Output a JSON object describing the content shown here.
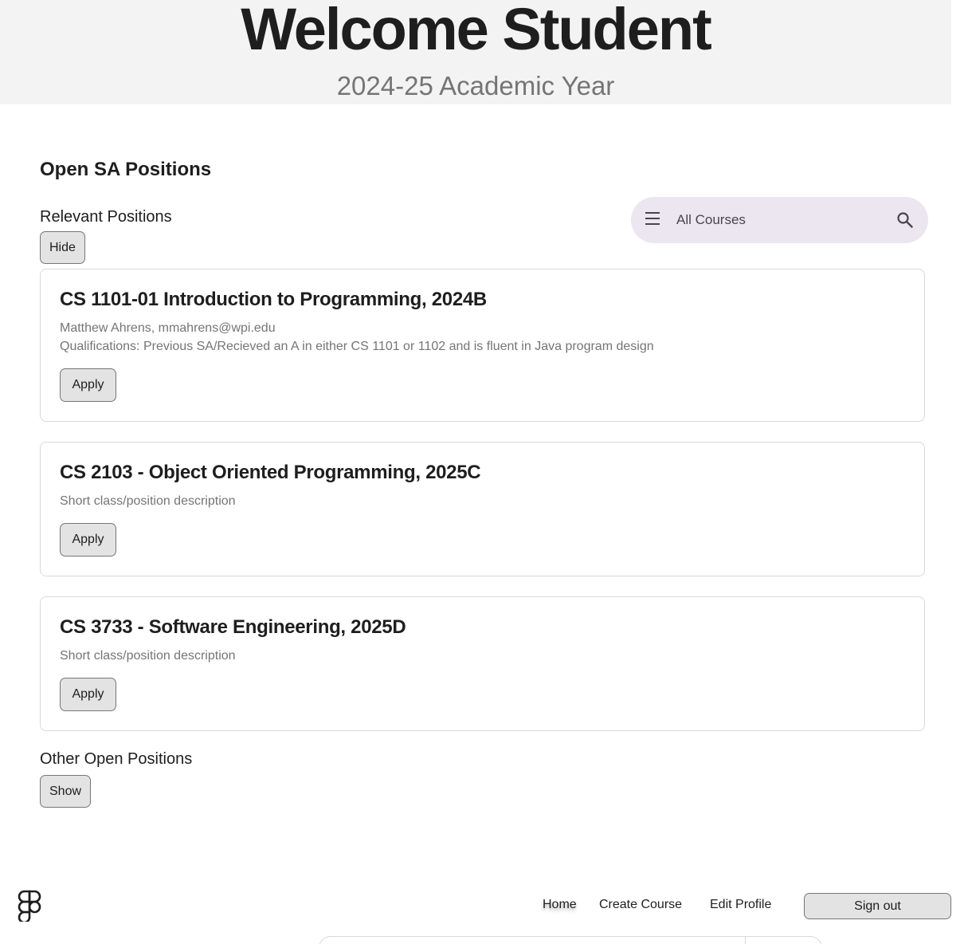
{
  "hero": {
    "title": "Welcome Student",
    "subtitle": "2024-25 Academic Year"
  },
  "main": {
    "section_title": "Open SA Positions",
    "relevant": {
      "label": "Relevant Positions",
      "toggle_label": "Hide"
    },
    "search": {
      "placeholder": "All Courses",
      "menu_icon": "menu-icon",
      "search_icon": "search-icon"
    },
    "positions": [
      {
        "title": "CS 1101-01 Introduction to Programming, 2024B",
        "line1": "Matthew Ahrens, mmahrens@wpi.edu",
        "line2": "Qualifications: Previous SA/Recieved an A in either CS 1101 or 1102 and is fluent in Java program design",
        "apply_label": "Apply"
      },
      {
        "title": "CS 2103 - Object Oriented Programming, 2025C",
        "line1": "Short class/position description",
        "apply_label": "Apply"
      },
      {
        "title": "CS 3733 - Software Engineering, 2025D",
        "line1": "Short class/position description",
        "apply_label": "Apply"
      }
    ],
    "other": {
      "label": "Other Open Positions",
      "toggle_label": "Show"
    }
  },
  "footer": {
    "logo_icon": "figma-logo-icon",
    "nav": [
      "Home",
      "Create Course",
      "Edit Profile"
    ],
    "signout_label": "Sign out"
  },
  "colors": {
    "hero_bg": "#f3f3f3",
    "search_bg": "#ece6f0",
    "button_bg": "#e3e3e3",
    "text": "#1e1e1e",
    "muted": "#757575"
  }
}
